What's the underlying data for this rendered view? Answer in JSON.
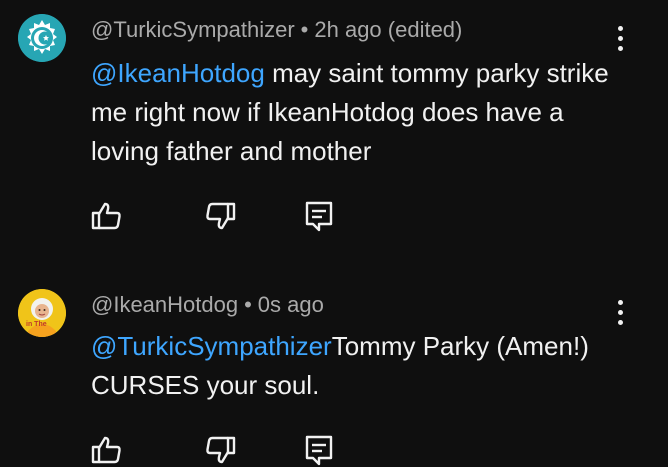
{
  "comments": [
    {
      "author": "@TurkicSympathizer",
      "separator": "•",
      "time": "2h ago (edited)",
      "mention": "@IkeanHotdog",
      "body": " may saint tommy parky strike me right now if IkeanHotdog does have a loving father and mother",
      "avatar_icon": "crescent-star-emblem",
      "avatar_color": "#27a6b4"
    },
    {
      "author": "@IkeanHotdog",
      "separator": "•",
      "time": "0s ago",
      "mention": "@TurkicSympathizer",
      "body": "Tommy Parky (Amen!) CURSES your soul.",
      "avatar_icon": "portrait-photo",
      "avatar_label": "in The",
      "avatar_color": "#f0c419"
    }
  ],
  "icons": {
    "like": "thumbs-up-icon",
    "dislike": "thumbs-down-icon",
    "reply": "reply-icon",
    "more": "more-vert-icon"
  },
  "colors": {
    "background": "#0f0f0f",
    "text": "#f1f1f1",
    "meta": "#aaaaaa",
    "mention": "#3ea6ff"
  }
}
